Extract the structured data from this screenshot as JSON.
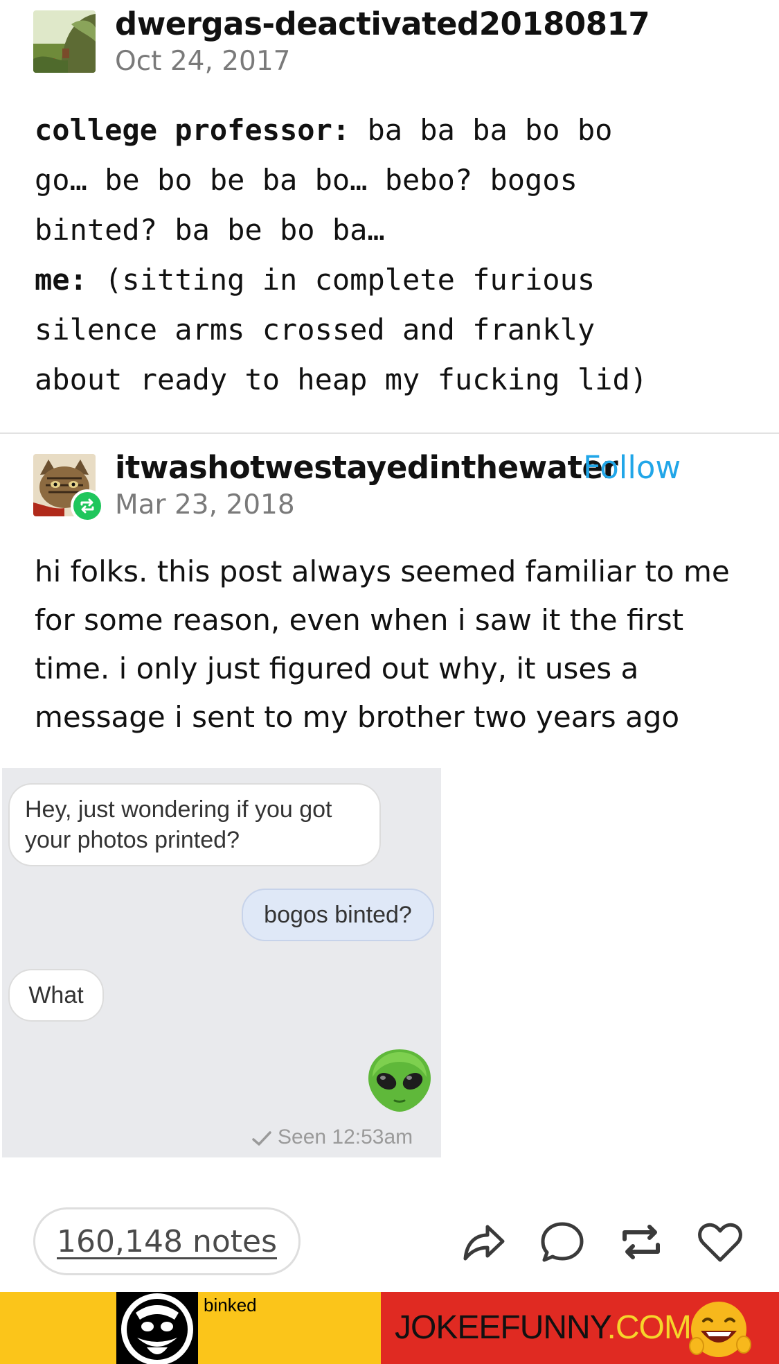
{
  "post1": {
    "username": "dwergas-deactivated20180817",
    "date": "Oct 24, 2017",
    "lines": [
      {
        "bold": "college professor:",
        "text": " ba ba ba bo bo"
      },
      {
        "bold": "",
        "text": "go… be bo be ba bo… bebo? bogos"
      },
      {
        "bold": "",
        "text": "binted? ba be bo ba…"
      },
      {
        "bold": "me:",
        "text": " (sitting in complete furious"
      },
      {
        "bold": "",
        "text": "silence arms crossed and frankly"
      },
      {
        "bold": "",
        "text": "about ready to heap my fucking lid)"
      }
    ]
  },
  "post2": {
    "username": "itwashotwestayedinthewater",
    "follow_label": "Follow",
    "date": "Mar 23, 2018",
    "lines": [
      "hi folks. this post always seemed familiar to me",
      "for some reason, even when i saw it the first",
      "time. i only just figured out why, it uses a",
      "message i sent to my brother two years ago"
    ]
  },
  "chat": {
    "msg1_line1": "Hey, just wondering if you got",
    "msg1_line2": "your photos printed?",
    "msg2": "bogos binted?",
    "msg3": "What",
    "seen": "Seen 12:53am"
  },
  "footer": {
    "notes": "160,148 notes"
  },
  "ad": {
    "binked": "binked",
    "brand_main": "JOKEEFUNNY",
    "brand_tld": ".COM"
  },
  "colors": {
    "follow": "#21a6e8",
    "reblog_badge": "#1fc65c",
    "ad_yellow": "#fbc51a",
    "ad_red": "#e02a22"
  }
}
